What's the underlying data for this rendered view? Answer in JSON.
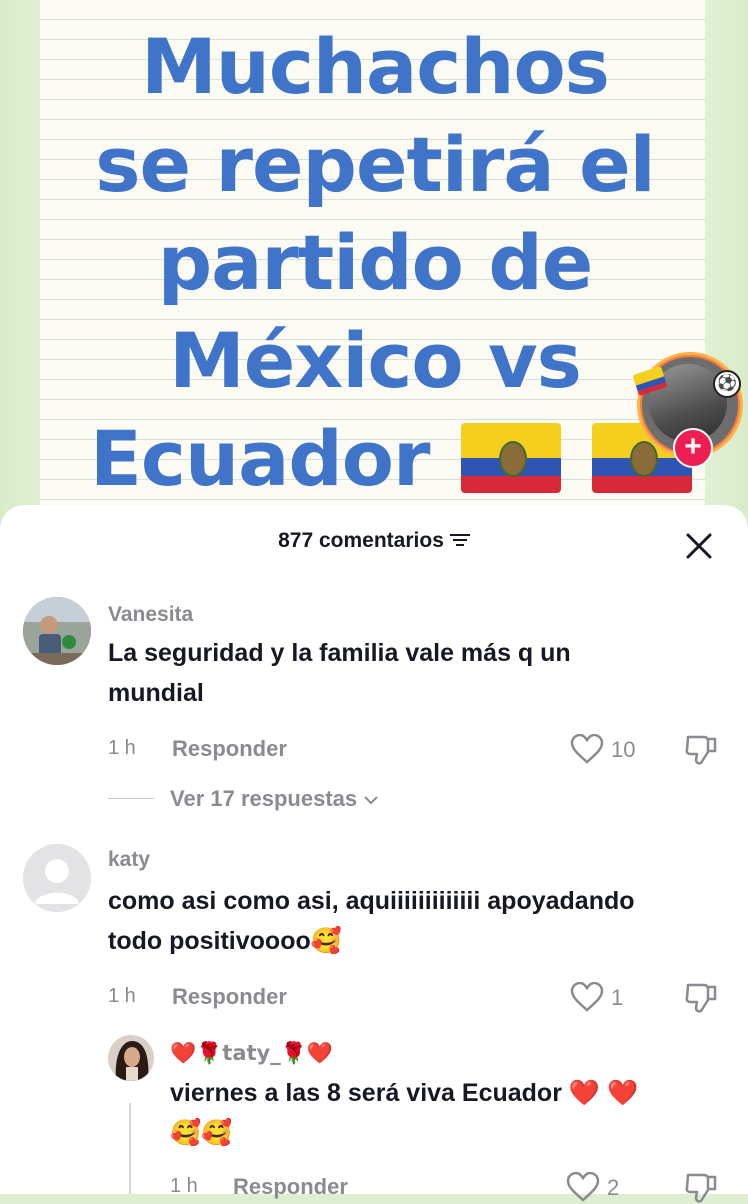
{
  "video": {
    "headline_lines": [
      "Muchachos",
      "se repetirá el",
      "partido de",
      "México vs",
      "Ecuador"
    ],
    "flags": [
      "ecuador-flag",
      "ecuador-flag"
    ]
  },
  "sheet": {
    "title": "877 comentarios",
    "filter_icon": "filter-icon",
    "close_icon": "close-icon"
  },
  "comments": [
    {
      "username": "Vanesita",
      "text": "La seguridad y la familia vale más q un mundial",
      "text_lines": [
        "La seguridad y la familia vale más q un",
        "mundial"
      ],
      "time": "1 h",
      "reply_label": "Responder",
      "likes": "10",
      "view_replies": "Ver 17 respuestas"
    },
    {
      "username": "katy",
      "text_lines": [
        "como asi como asi, aquiiiiiiiiiiiii apoyadando",
        "todo positivoooo🥰"
      ],
      "time": "1 h",
      "reply_label": "Responder",
      "likes": "1"
    }
  ],
  "reply": {
    "username": "❤️🌹taty_🌹❤️",
    "text_lines": [
      "viernes a las 8 será viva Ecuador ❤️ ❤️",
      "🥰🥰"
    ],
    "time": "1 h",
    "reply_label": "Responder",
    "likes": "2"
  },
  "colors": {
    "headline": "#3f74c9",
    "text": "#161823",
    "muted": "#8a8b91",
    "follow_plus": "#ee1d52"
  }
}
